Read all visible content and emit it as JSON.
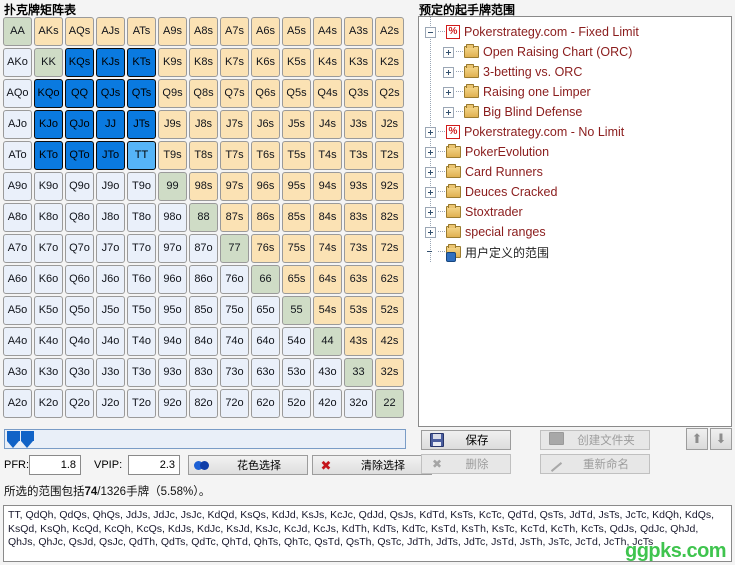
{
  "titles": {
    "matrix": "扑克牌矩阵表",
    "ranges": "预定的起手牌范围"
  },
  "matrix": {
    "rows": [
      [
        {
          "t": "AA",
          "s": "pair sel-none"
        },
        {
          "t": "AKs",
          "s": "suited"
        },
        {
          "t": "AQs",
          "s": "suited"
        },
        {
          "t": "AJs",
          "s": "suited"
        },
        {
          "t": "ATs",
          "s": "suited"
        },
        {
          "t": "A9s",
          "s": "suited"
        },
        {
          "t": "A8s",
          "s": "suited"
        },
        {
          "t": "A7s",
          "s": "suited"
        },
        {
          "t": "A6s",
          "s": "suited"
        },
        {
          "t": "A5s",
          "s": "suited"
        },
        {
          "t": "A4s",
          "s": "suited"
        },
        {
          "t": "A3s",
          "s": "suited"
        },
        {
          "t": "A2s",
          "s": "suited"
        }
      ],
      [
        {
          "t": "AKo",
          "s": "offsuit"
        },
        {
          "t": "KK",
          "s": "pair"
        },
        {
          "t": "KQs",
          "s": "sel"
        },
        {
          "t": "KJs",
          "s": "sel"
        },
        {
          "t": "KTs",
          "s": "sel"
        },
        {
          "t": "K9s",
          "s": "suited"
        },
        {
          "t": "K8s",
          "s": "suited"
        },
        {
          "t": "K7s",
          "s": "suited"
        },
        {
          "t": "K6s",
          "s": "suited"
        },
        {
          "t": "K5s",
          "s": "suited"
        },
        {
          "t": "K4s",
          "s": "suited"
        },
        {
          "t": "K3s",
          "s": "suited"
        },
        {
          "t": "K2s",
          "s": "suited"
        }
      ],
      [
        {
          "t": "AQo",
          "s": "offsuit"
        },
        {
          "t": "KQo",
          "s": "sel"
        },
        {
          "t": "QQ",
          "s": "sel"
        },
        {
          "t": "QJs",
          "s": "sel"
        },
        {
          "t": "QTs",
          "s": "sel"
        },
        {
          "t": "Q9s",
          "s": "suited"
        },
        {
          "t": "Q8s",
          "s": "suited"
        },
        {
          "t": "Q7s",
          "s": "suited"
        },
        {
          "t": "Q6s",
          "s": "suited"
        },
        {
          "t": "Q5s",
          "s": "suited"
        },
        {
          "t": "Q4s",
          "s": "suited"
        },
        {
          "t": "Q3s",
          "s": "suited"
        },
        {
          "t": "Q2s",
          "s": "suited"
        }
      ],
      [
        {
          "t": "AJo",
          "s": "offsuit"
        },
        {
          "t": "KJo",
          "s": "sel"
        },
        {
          "t": "QJo",
          "s": "sel"
        },
        {
          "t": "JJ",
          "s": "sel"
        },
        {
          "t": "JTs",
          "s": "sel"
        },
        {
          "t": "J9s",
          "s": "suited"
        },
        {
          "t": "J8s",
          "s": "suited"
        },
        {
          "t": "J7s",
          "s": "suited"
        },
        {
          "t": "J6s",
          "s": "suited"
        },
        {
          "t": "J5s",
          "s": "suited"
        },
        {
          "t": "J4s",
          "s": "suited"
        },
        {
          "t": "J3s",
          "s": "suited"
        },
        {
          "t": "J2s",
          "s": "suited"
        }
      ],
      [
        {
          "t": "ATo",
          "s": "offsuit"
        },
        {
          "t": "KTo",
          "s": "sel"
        },
        {
          "t": "QTo",
          "s": "sel"
        },
        {
          "t": "JTo",
          "s": "sel"
        },
        {
          "t": "TT",
          "s": "sel-part"
        },
        {
          "t": "T9s",
          "s": "suited"
        },
        {
          "t": "T8s",
          "s": "suited"
        },
        {
          "t": "T7s",
          "s": "suited"
        },
        {
          "t": "T6s",
          "s": "suited"
        },
        {
          "t": "T5s",
          "s": "suited"
        },
        {
          "t": "T4s",
          "s": "suited"
        },
        {
          "t": "T3s",
          "s": "suited"
        },
        {
          "t": "T2s",
          "s": "suited"
        }
      ],
      [
        {
          "t": "A9o",
          "s": "offsuit"
        },
        {
          "t": "K9o",
          "s": "offsuit"
        },
        {
          "t": "Q9o",
          "s": "offsuit"
        },
        {
          "t": "J9o",
          "s": "offsuit"
        },
        {
          "t": "T9o",
          "s": "offsuit"
        },
        {
          "t": "99",
          "s": "pair"
        },
        {
          "t": "98s",
          "s": "suited"
        },
        {
          "t": "97s",
          "s": "suited"
        },
        {
          "t": "96s",
          "s": "suited"
        },
        {
          "t": "95s",
          "s": "suited"
        },
        {
          "t": "94s",
          "s": "suited"
        },
        {
          "t": "93s",
          "s": "suited"
        },
        {
          "t": "92s",
          "s": "suited"
        }
      ],
      [
        {
          "t": "A8o",
          "s": "offsuit"
        },
        {
          "t": "K8o",
          "s": "offsuit"
        },
        {
          "t": "Q8o",
          "s": "offsuit"
        },
        {
          "t": "J8o",
          "s": "offsuit"
        },
        {
          "t": "T8o",
          "s": "offsuit"
        },
        {
          "t": "98o",
          "s": "offsuit"
        },
        {
          "t": "88",
          "s": "pair"
        },
        {
          "t": "87s",
          "s": "suited"
        },
        {
          "t": "86s",
          "s": "suited"
        },
        {
          "t": "85s",
          "s": "suited"
        },
        {
          "t": "84s",
          "s": "suited"
        },
        {
          "t": "83s",
          "s": "suited"
        },
        {
          "t": "82s",
          "s": "suited"
        }
      ],
      [
        {
          "t": "A7o",
          "s": "offsuit"
        },
        {
          "t": "K7o",
          "s": "offsuit"
        },
        {
          "t": "Q7o",
          "s": "offsuit"
        },
        {
          "t": "J7o",
          "s": "offsuit"
        },
        {
          "t": "T7o",
          "s": "offsuit"
        },
        {
          "t": "97o",
          "s": "offsuit"
        },
        {
          "t": "87o",
          "s": "offsuit"
        },
        {
          "t": "77",
          "s": "pair"
        },
        {
          "t": "76s",
          "s": "suited"
        },
        {
          "t": "75s",
          "s": "suited"
        },
        {
          "t": "74s",
          "s": "suited"
        },
        {
          "t": "73s",
          "s": "suited"
        },
        {
          "t": "72s",
          "s": "suited"
        }
      ],
      [
        {
          "t": "A6o",
          "s": "offsuit"
        },
        {
          "t": "K6o",
          "s": "offsuit"
        },
        {
          "t": "Q6o",
          "s": "offsuit"
        },
        {
          "t": "J6o",
          "s": "offsuit"
        },
        {
          "t": "T6o",
          "s": "offsuit"
        },
        {
          "t": "96o",
          "s": "offsuit"
        },
        {
          "t": "86o",
          "s": "offsuit"
        },
        {
          "t": "76o",
          "s": "offsuit"
        },
        {
          "t": "66",
          "s": "pair"
        },
        {
          "t": "65s",
          "s": "suited"
        },
        {
          "t": "64s",
          "s": "suited"
        },
        {
          "t": "63s",
          "s": "suited"
        },
        {
          "t": "62s",
          "s": "suited"
        }
      ],
      [
        {
          "t": "A5o",
          "s": "offsuit"
        },
        {
          "t": "K5o",
          "s": "offsuit"
        },
        {
          "t": "Q5o",
          "s": "offsuit"
        },
        {
          "t": "J5o",
          "s": "offsuit"
        },
        {
          "t": "T5o",
          "s": "offsuit"
        },
        {
          "t": "95o",
          "s": "offsuit"
        },
        {
          "t": "85o",
          "s": "offsuit"
        },
        {
          "t": "75o",
          "s": "offsuit"
        },
        {
          "t": "65o",
          "s": "offsuit"
        },
        {
          "t": "55",
          "s": "pair"
        },
        {
          "t": "54s",
          "s": "suited"
        },
        {
          "t": "53s",
          "s": "suited"
        },
        {
          "t": "52s",
          "s": "suited"
        }
      ],
      [
        {
          "t": "A4o",
          "s": "offsuit"
        },
        {
          "t": "K4o",
          "s": "offsuit"
        },
        {
          "t": "Q4o",
          "s": "offsuit"
        },
        {
          "t": "J4o",
          "s": "offsuit"
        },
        {
          "t": "T4o",
          "s": "offsuit"
        },
        {
          "t": "94o",
          "s": "offsuit"
        },
        {
          "t": "84o",
          "s": "offsuit"
        },
        {
          "t": "74o",
          "s": "offsuit"
        },
        {
          "t": "64o",
          "s": "offsuit"
        },
        {
          "t": "54o",
          "s": "offsuit"
        },
        {
          "t": "44",
          "s": "pair"
        },
        {
          "t": "43s",
          "s": "suited"
        },
        {
          "t": "42s",
          "s": "suited"
        }
      ],
      [
        {
          "t": "A3o",
          "s": "offsuit"
        },
        {
          "t": "K3o",
          "s": "offsuit"
        },
        {
          "t": "Q3o",
          "s": "offsuit"
        },
        {
          "t": "J3o",
          "s": "offsuit"
        },
        {
          "t": "T3o",
          "s": "offsuit"
        },
        {
          "t": "93o",
          "s": "offsuit"
        },
        {
          "t": "83o",
          "s": "offsuit"
        },
        {
          "t": "73o",
          "s": "offsuit"
        },
        {
          "t": "63o",
          "s": "offsuit"
        },
        {
          "t": "53o",
          "s": "offsuit"
        },
        {
          "t": "43o",
          "s": "offsuit"
        },
        {
          "t": "33",
          "s": "pair"
        },
        {
          "t": "32s",
          "s": "suited"
        }
      ],
      [
        {
          "t": "A2o",
          "s": "offsuit"
        },
        {
          "t": "K2o",
          "s": "offsuit"
        },
        {
          "t": "Q2o",
          "s": "offsuit"
        },
        {
          "t": "J2o",
          "s": "offsuit"
        },
        {
          "t": "T2o",
          "s": "offsuit"
        },
        {
          "t": "92o",
          "s": "offsuit"
        },
        {
          "t": "82o",
          "s": "offsuit"
        },
        {
          "t": "72o",
          "s": "offsuit"
        },
        {
          "t": "62o",
          "s": "offsuit"
        },
        {
          "t": "52o",
          "s": "offsuit"
        },
        {
          "t": "42o",
          "s": "offsuit"
        },
        {
          "t": "32o",
          "s": "offsuit"
        },
        {
          "t": "22",
          "s": "pair"
        }
      ]
    ],
    "colors": {
      "pair": "#cfdcc6",
      "suited": "#fbe2b4",
      "offsuit": "#eaf0fa",
      "selected": "#0a7ae0",
      "selected_partial": "#56b4f7"
    }
  },
  "controls": {
    "pfr_label": "PFR:",
    "pfr_value": "1.8",
    "vpip_label": "VPIP:",
    "vpip_value": "2.3",
    "suit_select_label": "花色选择",
    "clear_select_label": "清除选择"
  },
  "summary": {
    "prefix": "所选的范围包括",
    "count": "74",
    "middle": "/1326手牌（",
    "percent": "5.58%",
    "suffix": "）。"
  },
  "hands": {
    "text": "TT, QdQh, QdQs, QhQs, JdJs, JdJc, JsJc, KdQd, KsQs, KdJd, KsJs, KcJc, QdJd, QsJs, KdTd, KsTs, KcTc, QdTd, QsTs, JdTd, JsTs, JcTc, KdQh, KdQs, KsQd, KsQh, KcQd, KcQh, KcQs, KdJs, KdJc, KsJd, KsJc, KcJd, KcJs, KdTh, KdTs, KdTc, KsTd, KsTh, KsTc, KcTd, KcTh, KcTs, QdJs, QdJc, QhJd, QhJs, QhJc, QsJd, QsJc, QdTh, QdTs, QdTc, QhTd, QhTs, QhTc, QsTd, QsTh, QsTc, JdTh, JdTs, JdTc, JsTd, JsTh, JsTc, JcTd, JcTh, JcTs"
  },
  "tree": {
    "nodes": [
      {
        "label": "Pokerstrategy.com - Fixed Limit",
        "icon": "percent-icon",
        "twisty": "minus",
        "level": 1,
        "style": "root"
      },
      {
        "label": "Open Raising Chart (ORC)",
        "icon": "folder-icon",
        "twisty": "plus",
        "level": 2,
        "style": "child"
      },
      {
        "label": "3-betting vs. ORC",
        "icon": "folder-icon",
        "twisty": "plus",
        "level": 2,
        "style": "child"
      },
      {
        "label": "Raising one Limper",
        "icon": "folder-icon",
        "twisty": "plus",
        "level": 2,
        "style": "child"
      },
      {
        "label": "Big Blind Defense",
        "icon": "folder-icon",
        "twisty": "plus",
        "level": 2,
        "style": "child"
      },
      {
        "label": "Pokerstrategy.com - No Limit",
        "icon": "percent-icon",
        "twisty": "plus",
        "level": 1,
        "style": "root"
      },
      {
        "label": "PokerEvolution",
        "icon": "folder-icon",
        "twisty": "plus",
        "level": 1,
        "style": "root"
      },
      {
        "label": "Card Runners",
        "icon": "folder-icon",
        "twisty": "plus",
        "level": 1,
        "style": "root"
      },
      {
        "label": "Deuces Cracked",
        "icon": "folder-icon",
        "twisty": "plus",
        "level": 1,
        "style": "root"
      },
      {
        "label": "Stoxtrader",
        "icon": "folder-icon",
        "twisty": "plus",
        "level": 1,
        "style": "root"
      },
      {
        "label": "special ranges",
        "icon": "folder-icon",
        "twisty": "plus",
        "level": 1,
        "style": "root"
      },
      {
        "label": "用户定义的范围",
        "icon": "user-folder-icon",
        "twisty": "none",
        "level": 1,
        "style": "cn"
      }
    ]
  },
  "right_buttons": {
    "save": "保存",
    "delete": "删除",
    "new_folder": "创建文件夹",
    "rename": "重新命名"
  },
  "watermark": "ggpks.com"
}
